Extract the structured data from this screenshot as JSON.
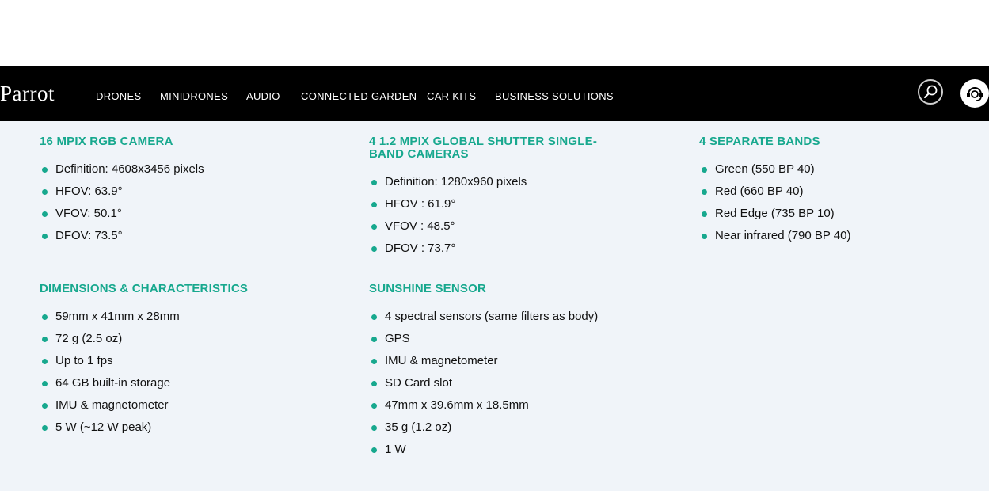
{
  "nav": {
    "logo": "Parrot",
    "links": [
      "DRONES",
      "MINIDRONES",
      "AUDIO",
      "CONNECTED GARDEN",
      "CAR KITS",
      "BUSINESS SOLUTIONS"
    ],
    "search_icon": "search-icon",
    "support_icon": "headset-support-icon"
  },
  "specs": [
    {
      "title": "16 MPIX RGB CAMERA",
      "items": [
        "Definition: 4608x3456 pixels",
        "HFOV: 63.9°",
        "VFOV: 50.1°",
        "DFOV: 73.5°"
      ]
    },
    {
      "title": "4 1.2 MPIX GLOBAL SHUTTER SINGLE-BAND CAMERAS",
      "items": [
        "Definition: 1280x960 pixels",
        "HFOV : 61.9°",
        "VFOV : 48.5°",
        "DFOV : 73.7°"
      ]
    },
    {
      "title": "4 SEPARATE BANDS",
      "items": [
        "Green (550 BP 40)",
        "Red (660 BP 40)",
        "Red Edge (735 BP 10)",
        "Near infrared (790 BP 40)"
      ]
    },
    {
      "title": "DIMENSIONS & CHARACTERISTICS",
      "items": [
        "59mm x 41mm x 28mm",
        "72 g (2.5 oz)",
        "Up to 1 fps",
        "64 GB built-in storage",
        "IMU & magnetometer",
        "5 W (~12 W peak)"
      ]
    },
    {
      "title": "SUNSHINE SENSOR",
      "items": [
        "4 spectral sensors (same filters as body)",
        "GPS",
        "IMU & magnetometer",
        "SD Card slot",
        "47mm x 39.6mm x 18.5mm",
        "35 g (1.2 oz)",
        "1 W"
      ]
    }
  ],
  "colors": {
    "accent": "#17a88e",
    "navbar": "#000000",
    "content_bg": "#f0f4f9"
  }
}
